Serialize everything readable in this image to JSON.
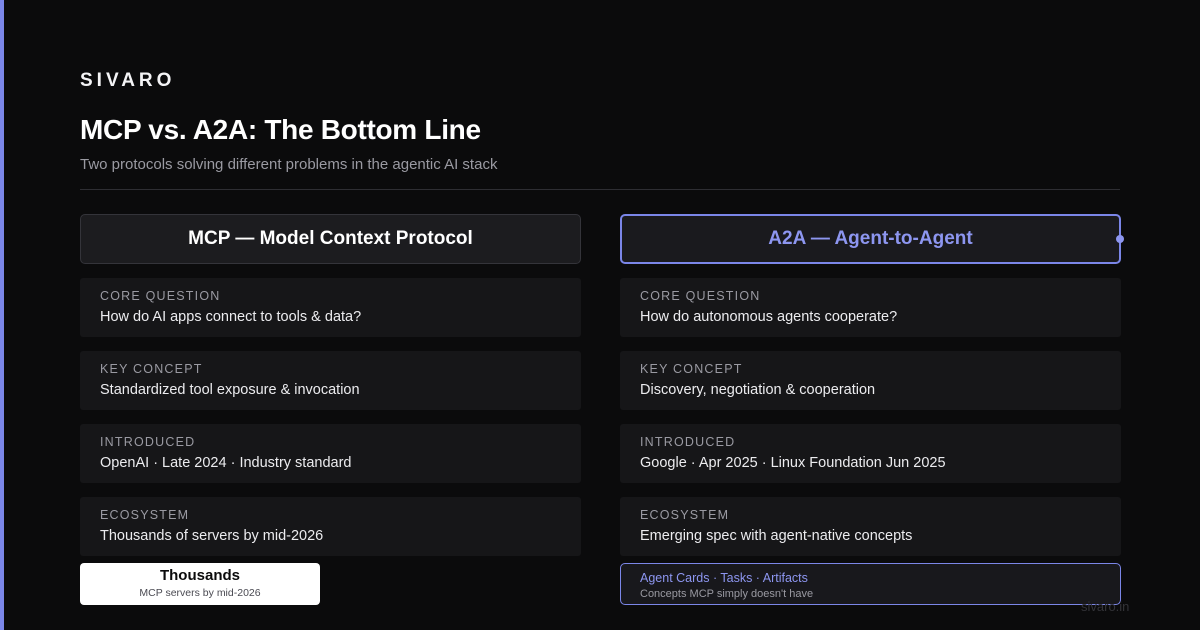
{
  "brand": "SIVARO",
  "title": "MCP vs. A2A: The Bottom Line",
  "subtitle": "Two protocols solving different problems in the agentic AI stack",
  "colors": {
    "background": "#0b0b0c",
    "accent": "#7b86e8",
    "accent_text": "#8d96f0",
    "card": "#161618"
  },
  "left": {
    "header": "MCP — Model Context Protocol",
    "cards": [
      {
        "label": "CORE QUESTION",
        "value": "How do AI apps connect to tools & data?"
      },
      {
        "label": "KEY CONCEPT",
        "value": "Standardized tool exposure & invocation"
      },
      {
        "label": "INTRODUCED",
        "value": "OpenAI · Late 2024 · Industry standard"
      },
      {
        "label": "ECOSYSTEM",
        "value": "Thousands of servers by mid-2026"
      }
    ],
    "highlight": {
      "value": "Thousands",
      "caption": "MCP servers by mid-2026"
    }
  },
  "right": {
    "header": "A2A — Agent-to-Agent",
    "cards": [
      {
        "label": "CORE QUESTION",
        "value": "How do autonomous agents cooperate?"
      },
      {
        "label": "KEY CONCEPT",
        "value": "Discovery, negotiation & cooperation"
      },
      {
        "label": "INTRODUCED",
        "value": "Google · Apr 2025 · Linux Foundation Jun 2025"
      },
      {
        "label": "ECOSYSTEM",
        "value": "Emerging spec with agent-native concepts"
      }
    ],
    "highlight": {
      "value": "Agent Cards · Tasks · Artifacts",
      "caption": "Concepts MCP simply doesn't have"
    }
  },
  "watermark": "sivaro.in"
}
